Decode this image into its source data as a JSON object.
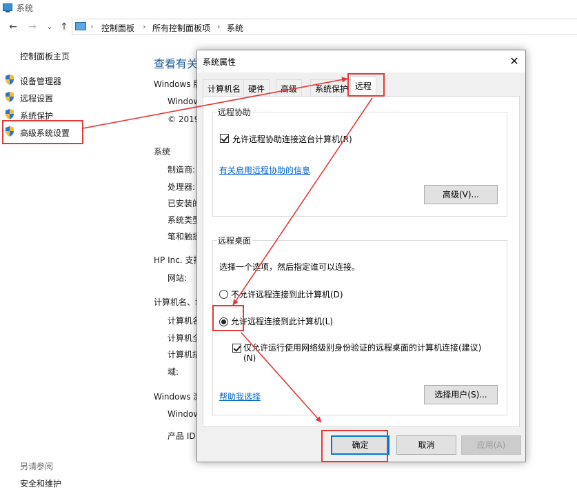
{
  "window": {
    "title": "系统"
  },
  "nav": {
    "back": "←",
    "forward": "→",
    "dropdown": "⌄",
    "up": "↑",
    "breadcrumb": [
      "控制面板",
      "所有控制面板项",
      "系统"
    ],
    "separator": "›"
  },
  "sidebar": {
    "home": "控制面板主页",
    "items": [
      {
        "label": "设备管理器",
        "icon": "shield-icon"
      },
      {
        "label": "远程设置",
        "icon": "shield-icon"
      },
      {
        "label": "系统保护",
        "icon": "shield-icon"
      },
      {
        "label": "高级系统设置",
        "icon": "shield-icon"
      }
    ],
    "see_also": "另请参阅",
    "see_also_items": [
      "安全和维护"
    ]
  },
  "main": {
    "heading": "查看有关",
    "lines": [
      "Windows 版",
      "Window",
      "© 2019",
      "系统",
      "制造商:",
      "处理器:",
      "已安装的",
      "系统类型",
      "笔和触摸",
      "HP Inc. 支持",
      "网站:",
      "计算机名、域",
      "计算机名",
      "计算机全",
      "计算机描",
      "域:",
      "Windows 激",
      "Window",
      "产品 ID"
    ]
  },
  "dialog": {
    "title": "系统属性",
    "close": "✕",
    "tabs": [
      "计算机名",
      "硬件",
      "高级",
      "系统保护",
      "远程"
    ],
    "active_tab": "远程",
    "remote_assistance": {
      "group_title": "远程协助",
      "checkbox_label": "允许远程协助连接这台计算机(R)",
      "checkbox_checked": true,
      "info_link": "有关启用远程协助的信息",
      "advanced_button": "高级(V)..."
    },
    "remote_desktop": {
      "group_title": "远程桌面",
      "instruction": "选择一个选项，然后指定谁可以连接。",
      "option_deny": "不允许远程连接到此计算机(D)",
      "option_allow": "允许远程连接到此计算机(L)",
      "selected": "allow",
      "nla_label": "仅允许运行使用网络级别身份验证的远程桌面的计算机连接(建议)",
      "nla_label_2": "(N)",
      "nla_checked": true,
      "help_link": "帮助我选择",
      "select_users_button": "选择用户(S)..."
    },
    "buttons": {
      "ok": "确定",
      "cancel": "取消",
      "apply": "应用(A)"
    }
  },
  "annotation": {
    "color": "#e53935"
  }
}
